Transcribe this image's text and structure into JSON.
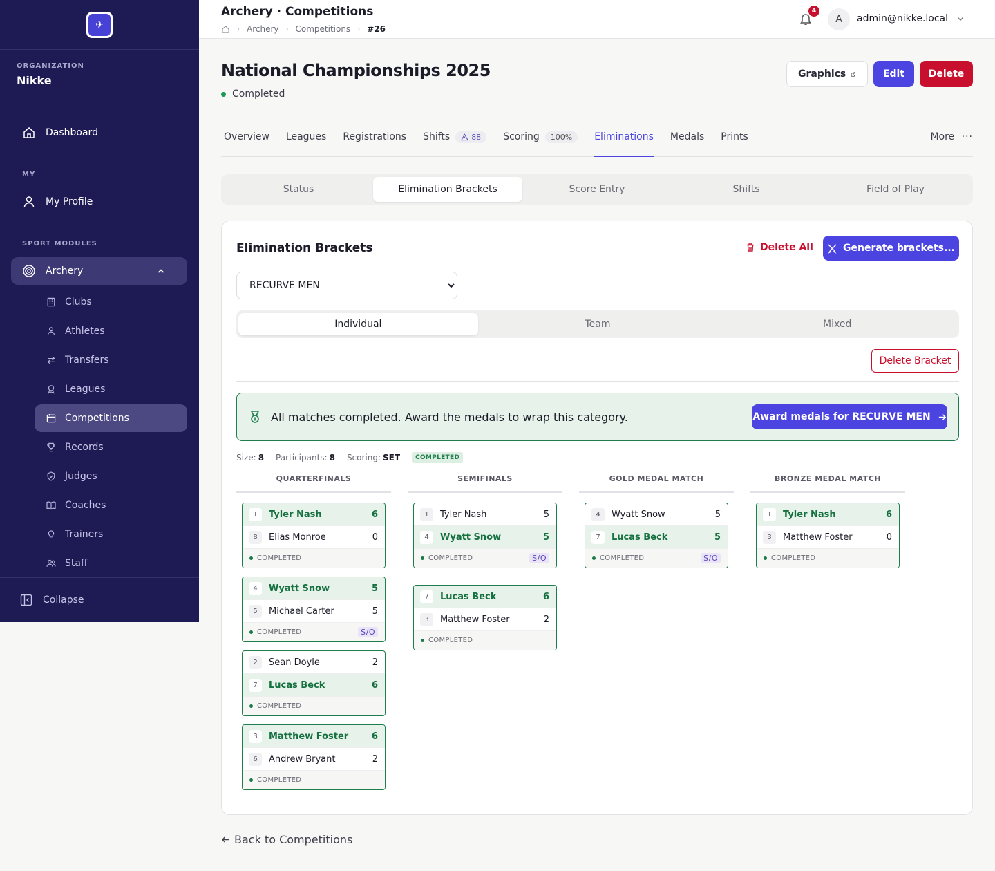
{
  "sidebar": {
    "org_label": "ORGANIZATION",
    "org_name": "Nikke",
    "dashboard": "Dashboard",
    "section_my": "MY",
    "my_profile": "My Profile",
    "section_sport": "SPORT MODULES",
    "archery": "Archery",
    "items": [
      {
        "label": "Clubs",
        "icon": "building-icon"
      },
      {
        "label": "Athletes",
        "icon": "user-icon"
      },
      {
        "label": "Transfers",
        "icon": "arrows-icon"
      },
      {
        "label": "Leagues",
        "icon": "ribbon-icon"
      },
      {
        "label": "Competitions",
        "icon": "calendar-icon"
      },
      {
        "label": "Records",
        "icon": "trophy-icon"
      },
      {
        "label": "Judges",
        "icon": "shield-icon"
      },
      {
        "label": "Coaches",
        "icon": "book-icon"
      },
      {
        "label": "Trainers",
        "icon": "lightbulb-icon"
      },
      {
        "label": "Staff",
        "icon": "users-icon"
      }
    ],
    "collapse": "Collapse"
  },
  "topbar": {
    "title": "Archery · Competitions",
    "breadcrumbs": [
      "Archery",
      "Competitions",
      "#26"
    ],
    "notifications": "4",
    "avatar": "A",
    "user": "admin@nikke.local"
  },
  "page": {
    "title": "National Championships 2025",
    "status": "Completed",
    "status_color": "#1a9a52",
    "graphics_label": "Graphics",
    "edit_label": "Edit",
    "delete_label": "Delete"
  },
  "tabs": {
    "overview": "Overview",
    "leagues": "Leagues",
    "registrations": "Registrations",
    "shifts": "Shifts",
    "shifts_count": "88",
    "scoring": "Scoring",
    "scoring_pct": "100%",
    "eliminations": "Eliminations",
    "medals": "Medals",
    "prints": "Prints",
    "more": "More"
  },
  "subtabs": [
    "Status",
    "Elimination Brackets",
    "Score Entry",
    "Shifts",
    "Field of Play"
  ],
  "brackets": {
    "title": "Elimination Brackets",
    "delete_all": "Delete All",
    "generate": "Generate brackets...",
    "category": "RECURVE MEN",
    "segments": [
      "Individual",
      "Team",
      "Mixed"
    ],
    "delete_bracket": "Delete Bracket",
    "banner_text": "All matches completed. Award the medals to wrap this category.",
    "banner_button": "Award medals for RECURVE MEN",
    "size_label": "Size:",
    "size": "8",
    "participants_label": "Participants:",
    "participants": "8",
    "scoring_label": "Scoring:",
    "scoring": "SET",
    "state": "COMPLETED",
    "rounds": [
      "QUARTERFINALS",
      "SEMIFINALS",
      "GOLD MEDAL MATCH",
      "BRONZE MEDAL MATCH"
    ],
    "matches": [
      {
        "round": 0,
        "a": {
          "seed": "1",
          "name": "Tyler Nash",
          "score": "6",
          "win": true
        },
        "b": {
          "seed": "8",
          "name": "Elias Monroe",
          "score": "0",
          "win": false
        },
        "status": "COMPLETED",
        "so": ""
      },
      {
        "round": 0,
        "a": {
          "seed": "4",
          "name": "Wyatt Snow",
          "score": "5",
          "win": true
        },
        "b": {
          "seed": "5",
          "name": "Michael Carter",
          "score": "5",
          "win": false
        },
        "status": "COMPLETED",
        "so": "S/O"
      },
      {
        "round": 0,
        "a": {
          "seed": "2",
          "name": "Sean Doyle",
          "score": "2",
          "win": false
        },
        "b": {
          "seed": "7",
          "name": "Lucas Beck",
          "score": "6",
          "win": true
        },
        "status": "COMPLETED",
        "so": ""
      },
      {
        "round": 0,
        "a": {
          "seed": "3",
          "name": "Matthew Foster",
          "score": "6",
          "win": true
        },
        "b": {
          "seed": "6",
          "name": "Andrew Bryant",
          "score": "2",
          "win": false
        },
        "status": "COMPLETED",
        "so": ""
      },
      {
        "round": 1,
        "a": {
          "seed": "1",
          "name": "Tyler Nash",
          "score": "5",
          "win": false
        },
        "b": {
          "seed": "4",
          "name": "Wyatt Snow",
          "score": "5",
          "win": true
        },
        "status": "COMPLETED",
        "so": "S/O"
      },
      {
        "round": 1,
        "a": {
          "seed": "7",
          "name": "Lucas Beck",
          "score": "6",
          "win": true
        },
        "b": {
          "seed": "3",
          "name": "Matthew Foster",
          "score": "2",
          "win": false
        },
        "status": "COMPLETED",
        "so": ""
      },
      {
        "round": 2,
        "a": {
          "seed": "4",
          "name": "Wyatt Snow",
          "score": "5",
          "win": false
        },
        "b": {
          "seed": "7",
          "name": "Lucas Beck",
          "score": "5",
          "win": true
        },
        "status": "COMPLETED",
        "so": "S/O"
      },
      {
        "round": 3,
        "a": {
          "seed": "1",
          "name": "Tyler Nash",
          "score": "6",
          "win": true
        },
        "b": {
          "seed": "3",
          "name": "Matthew Foster",
          "score": "0",
          "win": false
        },
        "status": "COMPLETED",
        "so": ""
      }
    ]
  },
  "back_label": "Back to Competitions",
  "colors": {
    "sidebar": "#1d1a54",
    "accent": "#4b44e0",
    "danger": "#c8102e",
    "success": "#1e7d4c"
  }
}
